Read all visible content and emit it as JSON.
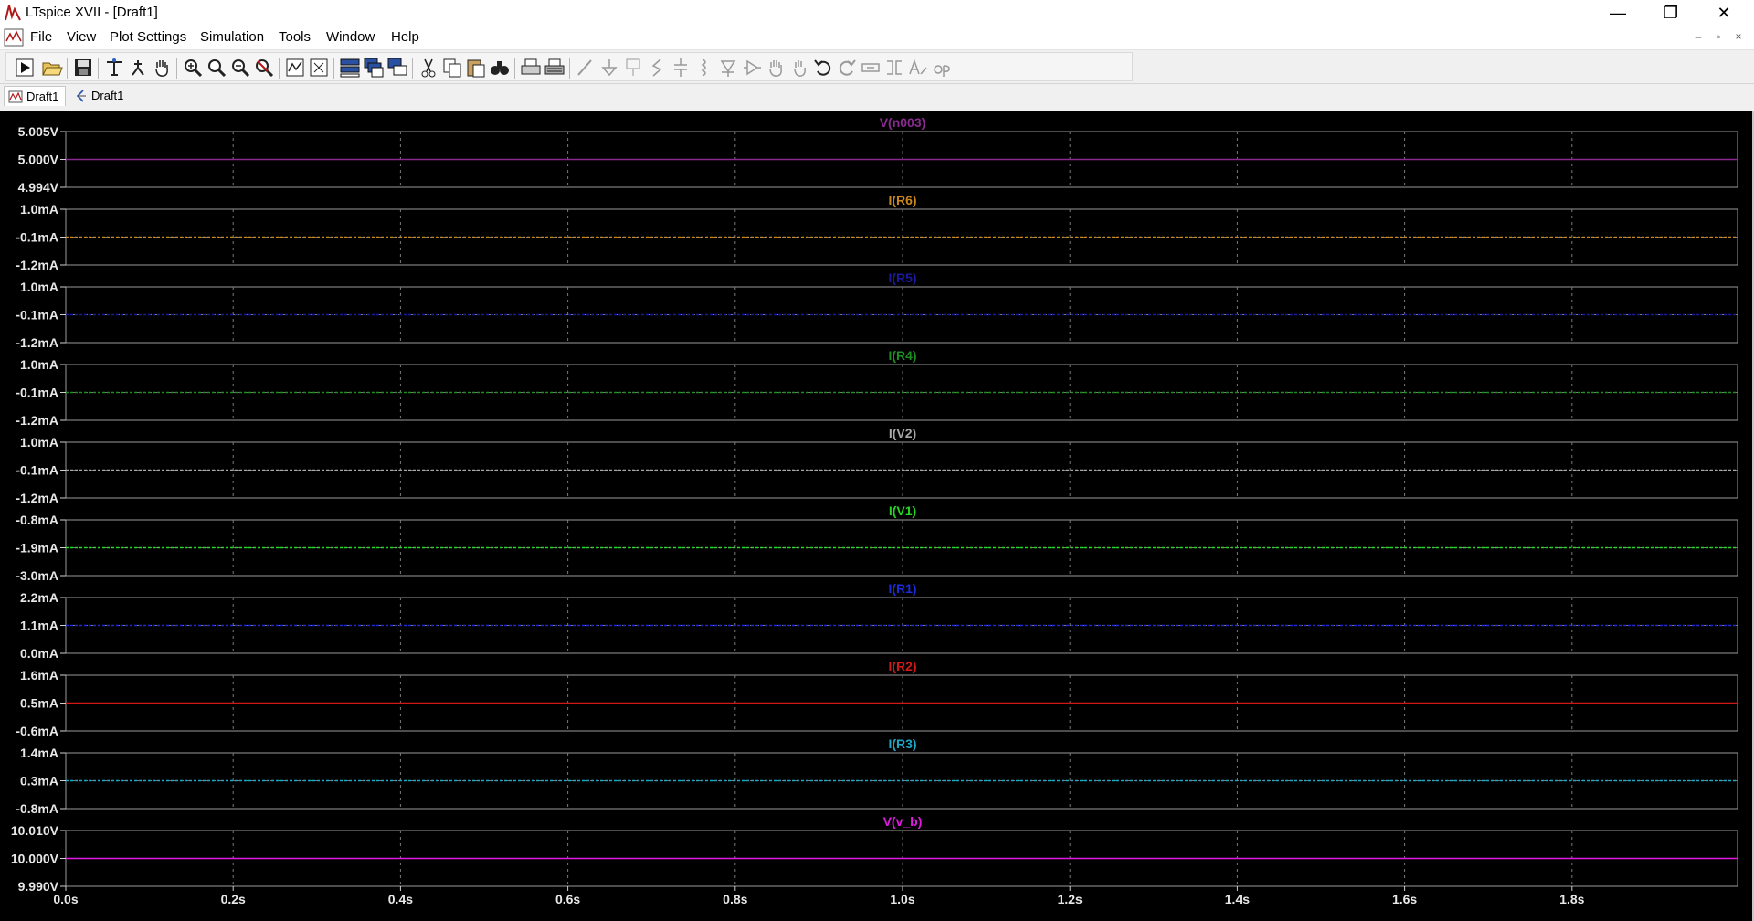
{
  "window": {
    "title": "LTspice XVII - [Draft1]",
    "controls": {
      "minimize": "—",
      "maximize": "❐",
      "close": "✕"
    }
  },
  "menu": {
    "items": [
      "File",
      "View",
      "Plot Settings",
      "Simulation",
      "Tools",
      "Window",
      "Help"
    ],
    "mdi_controls": {
      "minimize": "–",
      "restore": "▫",
      "close": "×"
    }
  },
  "toolbar": {
    "icons": [
      "run-icon",
      "open-icon",
      "save-icon",
      "control-panel-icon",
      "halt-icon",
      "pan-hand-icon",
      "zoom-in-icon",
      "zoom-area-icon",
      "zoom-out-icon",
      "zoom-cancel-icon",
      "autorange-icon",
      "fit-icon",
      "tile-horizontal-icon",
      "cascade-icon",
      "tile-vertical-icon",
      "cut-icon",
      "copy-icon",
      "paste-icon",
      "find-icon",
      "print-icon",
      "print-preview-icon",
      "wire-icon",
      "ground-icon",
      "label-net-icon",
      "resistor-icon",
      "capacitor-icon",
      "inductor-icon",
      "diode-icon",
      "component-icon",
      "move-icon",
      "drag-icon",
      "undo-icon",
      "redo-icon",
      "rotate-icon",
      "mirror-icon",
      "text-icon",
      "spice-directive-icon"
    ]
  },
  "tabs": [
    {
      "label": "Draft1",
      "type": "waveform",
      "active": true
    },
    {
      "label": "Draft1",
      "type": "schematic",
      "active": false
    }
  ],
  "plot": {
    "background": "#000000",
    "x_ticks": [
      "0.0s",
      "0.2s",
      "0.4s",
      "0.6s",
      "0.8s",
      "1.0s",
      "1.2s",
      "1.4s",
      "1.6s",
      "1.8s"
    ],
    "panes": [
      {
        "trace": "V(n003)",
        "color": "#8a2a90",
        "ticks": [
          "5.005V",
          "5.000V",
          "4.994V"
        ],
        "value_rel": 0.5,
        "dashed": false
      },
      {
        "trace": "I(R6)",
        "color": "#c9871c",
        "ticks": [
          "1.0mA",
          "-0.1mA",
          "-1.2mA"
        ],
        "value_rel": 0.5,
        "dashed": true
      },
      {
        "trace": "I(R5)",
        "color": "#1a1aa0",
        "ticks": [
          "1.0mA",
          "-0.1mA",
          "-1.2mA"
        ],
        "value_rel": 0.5,
        "dashed": true
      },
      {
        "trace": "I(R4)",
        "color": "#1f8c1f",
        "ticks": [
          "1.0mA",
          "-0.1mA",
          "-1.2mA"
        ],
        "value_rel": 0.5,
        "dashed": true
      },
      {
        "trace": "I(V2)",
        "color": "#a8a8a8",
        "ticks": [
          "1.0mA",
          "-0.1mA",
          "-1.2mA"
        ],
        "value_rel": 0.5,
        "dashed": true
      },
      {
        "trace": "I(V1)",
        "color": "#22d822",
        "ticks": [
          "-0.8mA",
          "-1.9mA",
          "-3.0mA"
        ],
        "value_rel": 0.5,
        "dashed": true
      },
      {
        "trace": "I(R1)",
        "color": "#1c2ad8",
        "ticks": [
          "2.2mA",
          "1.1mA",
          "0.0mA"
        ],
        "value_rel": 0.5,
        "dashed": true
      },
      {
        "trace": "I(R2)",
        "color": "#d01818",
        "ticks": [
          "1.6mA",
          "0.5mA",
          "-0.6mA"
        ],
        "value_rel": 0.5,
        "dashed": false
      },
      {
        "trace": "I(R3)",
        "color": "#1ba8c4",
        "ticks": [
          "1.4mA",
          "0.3mA",
          "-0.8mA"
        ],
        "value_rel": 0.5,
        "dashed": true
      },
      {
        "trace": "V(v_b)",
        "color": "#e01ae0",
        "ticks": [
          "10.010V",
          "10.000V",
          "9.990V"
        ],
        "value_rel": 0.5,
        "dashed": false
      }
    ]
  }
}
